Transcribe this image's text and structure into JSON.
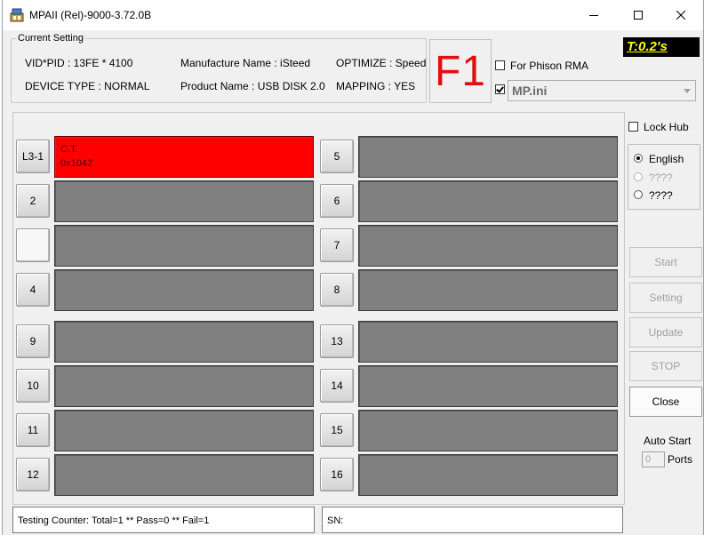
{
  "window": {
    "title": "MPAII (Rel)-9000-3.72.0B",
    "controls": [
      "minimize-icon",
      "maximize-icon",
      "close-icon"
    ]
  },
  "current_setting": {
    "legend": "Current Setting",
    "vid_pid": "VID*PID : 13FE * 4100",
    "manufacture": "Manufacture Name : iSteed",
    "optimize": "OPTIMIZE : Speed",
    "device_type": "DEVICE TYPE : NORMAL",
    "product": "Product Name : USB DISK 2.0",
    "mapping": "MAPPING : YES"
  },
  "mode_indicator": "F1",
  "timer": "T:0.2's",
  "for_phison_rma": {
    "label": "For Phison RMA",
    "checked": false
  },
  "mp_ini": {
    "checked": true,
    "value": "MP.ini"
  },
  "lock_hub": {
    "label": "Lock Hub",
    "checked": false
  },
  "language": {
    "options": [
      {
        "label": "English",
        "selected": true,
        "enabled": true
      },
      {
        "label": "????",
        "selected": false,
        "enabled": false
      },
      {
        "label": "????",
        "selected": false,
        "enabled": true
      }
    ]
  },
  "ports": {
    "left": [
      {
        "label": "L3-1",
        "active": true,
        "status": "C.T.",
        "code": "0x1042"
      },
      {
        "label": "2",
        "active": false
      },
      {
        "label": "",
        "active": false
      },
      {
        "label": "4",
        "active": false
      },
      {
        "label": "9",
        "active": false
      },
      {
        "label": "10",
        "active": false
      },
      {
        "label": "11",
        "active": false
      },
      {
        "label": "12",
        "active": false
      }
    ],
    "right": [
      {
        "label": "5",
        "active": false
      },
      {
        "label": "6",
        "active": false
      },
      {
        "label": "7",
        "active": false
      },
      {
        "label": "8",
        "active": false
      },
      {
        "label": "13",
        "active": false
      },
      {
        "label": "14",
        "active": false
      },
      {
        "label": "15",
        "active": false
      },
      {
        "label": "16",
        "active": false
      }
    ]
  },
  "buttons": {
    "start": "Start",
    "setting": "Setting",
    "update": "Update",
    "stop": "STOP",
    "close": "Close"
  },
  "auto_start": {
    "label": "Auto Start",
    "ports_value": "0",
    "ports_label": "Ports"
  },
  "status": {
    "counter": "Testing Counter: Total=1 ** Pass=0 ** Fail=1",
    "sn": "SN:"
  },
  "colors": {
    "active_port": "#ff0000",
    "idle_port": "#808080",
    "mode_text": "#e01010",
    "timer_bg": "#000000",
    "timer_text": "#ffff00"
  }
}
